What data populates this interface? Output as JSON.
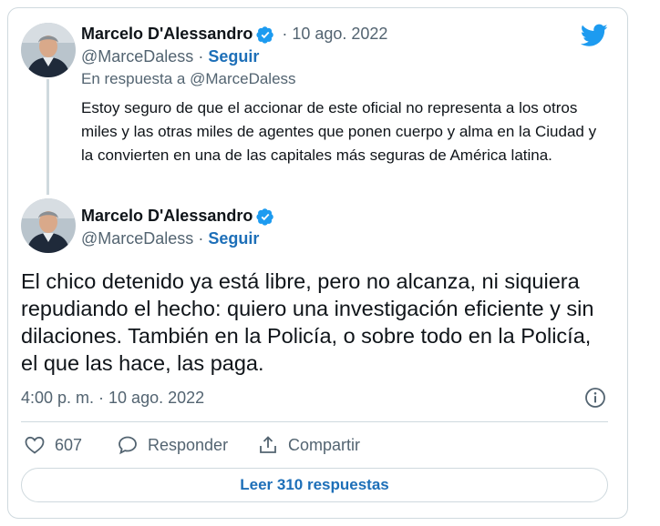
{
  "parent_tweet": {
    "author_name": "Marcelo D'Alessandro",
    "handle": "@MarceDaless",
    "separator": "·",
    "follow_label": "Seguir",
    "date": "10 ago. 2022",
    "reply_context": "En respuesta a @MarceDaless",
    "text": "Estoy seguro de que el accionar de este oficial no representa a los otros miles y las otras miles de agentes que ponen cuerpo y alma en la Ciudad y la convierten en una de las capitales más seguras de América latina."
  },
  "main_tweet": {
    "author_name": "Marcelo D'Alessandro",
    "handle": "@MarceDaless",
    "separator": "·",
    "follow_label": "Seguir",
    "text": "El chico detenido ya está libre, pero no alcanza, ni siquiera repudiando el hecho: quiero una investigación eficiente y sin dilaciones. También en la Policía, o sobre todo en la Policía, el que las hace, las paga.",
    "timestamp": "4:00 p. m. · 10 ago. 2022"
  },
  "actions": {
    "like_count": "607",
    "reply_label": "Responder",
    "share_label": "Compartir"
  },
  "read_replies_label": "Leer 310 respuestas",
  "icons": {
    "brand": "twitter-bird-icon",
    "verified": "verified-badge-icon",
    "info": "info-icon",
    "like": "heart-icon",
    "reply": "reply-bubble-icon",
    "share": "share-icon"
  },
  "colors": {
    "brand_blue": "#1d9bf0",
    "link_blue": "#1d6fb8",
    "muted_text": "#536471",
    "border": "#cfd9de"
  }
}
